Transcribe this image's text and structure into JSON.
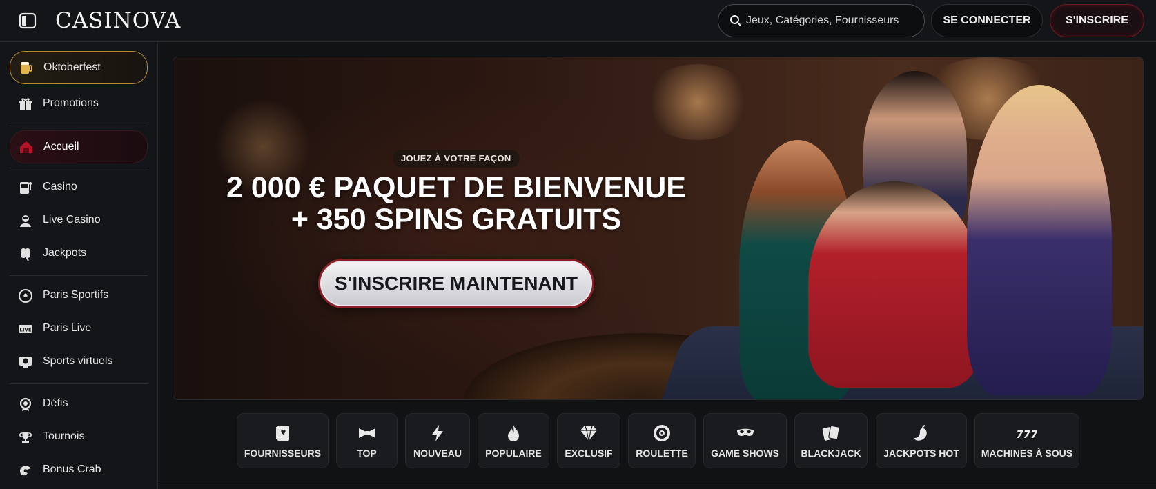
{
  "header": {
    "logo": "CASINOVA",
    "search_placeholder": "Jeux, Catégories, Fournisseurs",
    "login_label": "SE CONNECTER",
    "register_label": "S'INSCRIRE"
  },
  "sidebar": {
    "items": [
      {
        "label": "Oktoberfest",
        "icon": "beer-mug-icon"
      },
      {
        "label": "Promotions",
        "icon": "gift-icon"
      },
      {
        "label": "Accueil",
        "icon": "home-icon"
      },
      {
        "label": "Casino",
        "icon": "slot-machine-icon"
      },
      {
        "label": "Live Casino",
        "icon": "live-dealer-icon"
      },
      {
        "label": "Jackpots",
        "icon": "clover-icon"
      },
      {
        "label": "Paris Sportifs",
        "icon": "soccer-ball-icon"
      },
      {
        "label": "Paris Live",
        "icon": "live-badge-icon"
      },
      {
        "label": "Sports virtuels",
        "icon": "virtual-sports-icon"
      },
      {
        "label": "Défis",
        "icon": "medal-icon"
      },
      {
        "label": "Tournois",
        "icon": "trophy-icon"
      },
      {
        "label": "Bonus Crab",
        "icon": "crab-claw-icon"
      }
    ]
  },
  "hero": {
    "tag": "JOUEZ À VOTRE FAÇON",
    "title_line1": "2 000 € PAQUET DE BIENVENUE",
    "title_line2": "+ 350 SPINS GRATUITS",
    "cta": "S'INSCRIRE MAINTENANT"
  },
  "categories": [
    {
      "label": "FOURNISSEURS",
      "icon": "book-icon"
    },
    {
      "label": "TOP",
      "icon": "bow-tie-icon"
    },
    {
      "label": "NOUVEAU",
      "icon": "lightning-icon"
    },
    {
      "label": "POPULAIRE",
      "icon": "flame-icon"
    },
    {
      "label": "EXCLUSIF",
      "icon": "diamond-icon"
    },
    {
      "label": "ROULETTE",
      "icon": "roulette-icon"
    },
    {
      "label": "GAME SHOWS",
      "icon": "mask-icon"
    },
    {
      "label": "BLACKJACK",
      "icon": "cards-icon"
    },
    {
      "label": "JACKPOTS HOT",
      "icon": "hot-pepper-icon"
    },
    {
      "label": "MACHINES À SOUS",
      "icon": "seven-seven-seven-icon"
    }
  ],
  "colors": {
    "background": "#111214",
    "accent_gold": "#b38a3a",
    "accent_red": "#8a1e28"
  }
}
